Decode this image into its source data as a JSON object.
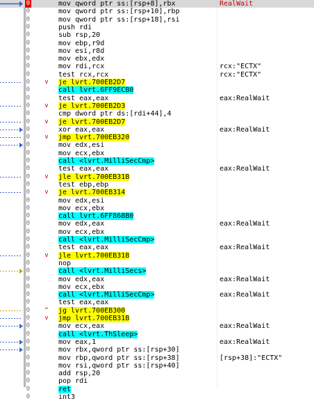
{
  "colors": {
    "breakpoint": "#e60000",
    "jump_highlight": "#ffff00",
    "call_highlight": "#00ffff",
    "comment_red": "#cc0000"
  },
  "rows": [
    {
      "bp": "0",
      "instr": "mov qword ptr ss:[rsp+8],rbx",
      "comment": "RealWait",
      "hl": "",
      "fold": "",
      "arrow": "blue-solid",
      "current": true
    },
    {
      "bp": "0",
      "instr": "mov qword ptr ss:[rsp+10],rbp",
      "comment": "",
      "hl": "",
      "fold": "",
      "arrow": ""
    },
    {
      "bp": "0",
      "instr": "mov qword ptr ss:[rsp+18],rsi",
      "comment": "",
      "hl": "",
      "fold": "",
      "arrow": ""
    },
    {
      "bp": "0",
      "instr": "push rdi",
      "comment": "",
      "hl": "",
      "fold": "",
      "arrow": ""
    },
    {
      "bp": "0",
      "instr": "sub rsp,20",
      "comment": "",
      "hl": "",
      "fold": "",
      "arrow": ""
    },
    {
      "bp": "0",
      "instr": "mov ebp,r9d",
      "comment": "",
      "hl": "",
      "fold": "",
      "arrow": ""
    },
    {
      "bp": "0",
      "instr": "mov esi,r8d",
      "comment": "",
      "hl": "",
      "fold": "",
      "arrow": ""
    },
    {
      "bp": "0",
      "instr": "mov ebx,edx",
      "comment": "",
      "hl": "",
      "fold": "",
      "arrow": ""
    },
    {
      "bp": "0",
      "instr": "mov rdi,rcx",
      "comment": "rcx:\"ECTX\"",
      "hl": "",
      "fold": "",
      "arrow": ""
    },
    {
      "bp": "0",
      "instr": "test rcx,rcx",
      "comment": "rcx:\"ECTX\"",
      "hl": "",
      "fold": "",
      "arrow": ""
    },
    {
      "bp": "0",
      "instr": "je lvrt.700EB2D7",
      "comment": "",
      "hl": "jmp",
      "fold": "v",
      "arrow": "blue-dashed"
    },
    {
      "bp": "0",
      "instr": "call lvrt.6FF9ECB0",
      "comment": "",
      "hl": "call",
      "fold": "",
      "arrow": ""
    },
    {
      "bp": "0",
      "instr": "test eax,eax",
      "comment": "eax:RealWait",
      "hl": "",
      "fold": "",
      "arrow": ""
    },
    {
      "bp": "0",
      "instr": "je lvrt.700EB2D3",
      "comment": "",
      "hl": "jmp",
      "fold": "v",
      "arrow": "blue-dashed"
    },
    {
      "bp": "0",
      "instr": "cmp dword ptr ds:[rdi+44],4",
      "comment": "",
      "hl": "",
      "fold": "",
      "arrow": ""
    },
    {
      "bp": "0",
      "instr": "je lvrt.700EB2D7",
      "comment": "",
      "hl": "jmp",
      "fold": "v",
      "arrow": "blue-dashed"
    },
    {
      "bp": "0",
      "instr": "xor eax,eax",
      "comment": "eax:RealWait",
      "hl": "",
      "fold": "",
      "arrow": "blue-in"
    },
    {
      "bp": "0",
      "instr": "jmp lvrt.700EB320",
      "comment": "",
      "hl": "jmp",
      "fold": "v",
      "arrow": "blue-dashed"
    },
    {
      "bp": "0",
      "instr": "mov edx,esi",
      "comment": "",
      "hl": "",
      "fold": "",
      "arrow": "blue-in"
    },
    {
      "bp": "0",
      "instr": "mov ecx,ebx",
      "comment": "",
      "hl": "",
      "fold": "",
      "arrow": ""
    },
    {
      "bp": "0",
      "instr": "call <lvrt.MilliSecCmp>",
      "comment": "",
      "hl": "call",
      "fold": "",
      "arrow": ""
    },
    {
      "bp": "0",
      "instr": "test eax,eax",
      "comment": "eax:RealWait",
      "hl": "",
      "fold": "",
      "arrow": ""
    },
    {
      "bp": "0",
      "instr": "jle lvrt.700EB31B",
      "comment": "",
      "hl": "jmp",
      "fold": "v",
      "arrow": "blue-dashed"
    },
    {
      "bp": "0",
      "instr": "test ebp,ebp",
      "comment": "",
      "hl": "",
      "fold": "",
      "arrow": ""
    },
    {
      "bp": "0",
      "instr": "je lvrt.700EB314",
      "comment": "",
      "hl": "jmp",
      "fold": "v",
      "arrow": "blue-dashed"
    },
    {
      "bp": "0",
      "instr": "mov edx,esi",
      "comment": "",
      "hl": "",
      "fold": "",
      "arrow": ""
    },
    {
      "bp": "0",
      "instr": "mov ecx,ebx",
      "comment": "",
      "hl": "",
      "fold": "",
      "arrow": ""
    },
    {
      "bp": "0",
      "instr": "call lvrt.6FF868B0",
      "comment": "",
      "hl": "call",
      "fold": "",
      "arrow": ""
    },
    {
      "bp": "0",
      "instr": "mov edx,eax",
      "comment": "eax:RealWait",
      "hl": "",
      "fold": "",
      "arrow": ""
    },
    {
      "bp": "0",
      "instr": "mov ecx,ebx",
      "comment": "",
      "hl": "",
      "fold": "",
      "arrow": ""
    },
    {
      "bp": "0",
      "instr": "call <lvrt.MilliSecCmp>",
      "comment": "",
      "hl": "call",
      "fold": "",
      "arrow": ""
    },
    {
      "bp": "0",
      "instr": "test eax,eax",
      "comment": "eax:RealWait",
      "hl": "",
      "fold": "",
      "arrow": ""
    },
    {
      "bp": "0",
      "instr": "jle lvrt.700EB31B",
      "comment": "",
      "hl": "jmp",
      "fold": "v",
      "arrow": "blue-dashed"
    },
    {
      "bp": "0",
      "instr": "nop",
      "comment": "",
      "hl": "",
      "fold": "",
      "arrow": ""
    },
    {
      "bp": "0",
      "instr": "call <lvrt.MilliSecs>",
      "comment": "",
      "hl": "call",
      "fold": "",
      "arrow": "yellow-in"
    },
    {
      "bp": "0",
      "instr": "mov edx,eax",
      "comment": "eax:RealWait",
      "hl": "",
      "fold": "",
      "arrow": ""
    },
    {
      "bp": "0",
      "instr": "mov ecx,ebx",
      "comment": "",
      "hl": "",
      "fold": "",
      "arrow": ""
    },
    {
      "bp": "0",
      "instr": "call <lvrt.MilliSecCmp>",
      "comment": "eax:RealWait",
      "hl": "call",
      "fold": "",
      "arrow": ""
    },
    {
      "bp": "0",
      "instr": "test eax,eax",
      "comment": "",
      "hl": "",
      "fold": "",
      "arrow": ""
    },
    {
      "bp": "0",
      "instr": "jg lvrt.700EB300",
      "comment": "",
      "hl": "jmp",
      "fold": "^",
      "arrow": "yellow-out"
    },
    {
      "bp": "0",
      "instr": "jmp lvrt.700EB31B",
      "comment": "",
      "hl": "jmp",
      "fold": "v",
      "arrow": "blue-dashed"
    },
    {
      "bp": "0",
      "instr": "mov ecx,eax",
      "comment": "eax:RealWait",
      "hl": "",
      "fold": "",
      "arrow": "blue-in"
    },
    {
      "bp": "0",
      "instr": "call <lvrt.ThSleep>",
      "comment": "",
      "hl": "call",
      "fold": "",
      "arrow": ""
    },
    {
      "bp": "0",
      "instr": "mov eax,1",
      "comment": "eax:RealWait",
      "hl": "",
      "fold": "",
      "arrow": "blue-in"
    },
    {
      "bp": "0",
      "instr": "mov rbx,qword ptr ss:[rsp+30]",
      "comment": "",
      "hl": "",
      "fold": "",
      "arrow": "blue-in"
    },
    {
      "bp": "0",
      "instr": "mov rbp,qword ptr ss:[rsp+38]",
      "comment": "[rsp+38]:\"ECTX\"",
      "hl": "",
      "fold": "",
      "arrow": ""
    },
    {
      "bp": "0",
      "instr": "mov rsi,qword ptr ss:[rsp+40]",
      "comment": "",
      "hl": "",
      "fold": "",
      "arrow": ""
    },
    {
      "bp": "0",
      "instr": "add rsp,20",
      "comment": "",
      "hl": "",
      "fold": "",
      "arrow": ""
    },
    {
      "bp": "0",
      "instr": "pop rdi",
      "comment": "",
      "hl": "",
      "fold": "",
      "arrow": ""
    },
    {
      "bp": "0",
      "instr": "ret",
      "comment": "",
      "hl": "call",
      "fold": "",
      "arrow": ""
    },
    {
      "bp": "0",
      "instr": "int3",
      "comment": "",
      "hl": "",
      "fold": "",
      "arrow": ""
    }
  ]
}
